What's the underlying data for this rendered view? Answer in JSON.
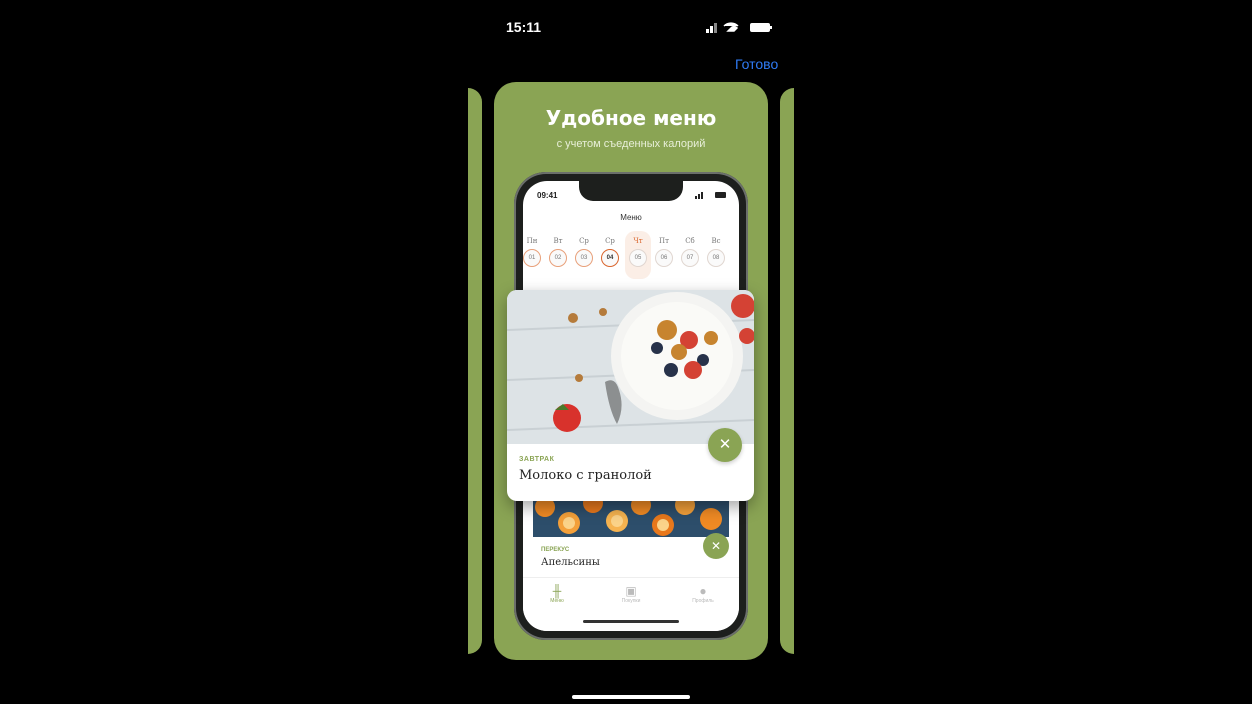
{
  "status_bar": {
    "time": "15:11"
  },
  "nav": {
    "done_label": "Готово"
  },
  "promo": {
    "title": "Удобное меню",
    "subtitle": "с учетом съеденных калорий",
    "accent_color": "#8aa454"
  },
  "phone": {
    "time": "09:41",
    "header": "Меню",
    "days": [
      {
        "name": "Пн",
        "num": "01"
      },
      {
        "name": "Вт",
        "num": "02"
      },
      {
        "name": "Ср",
        "num": "03"
      },
      {
        "name": "Ср",
        "num": "04"
      },
      {
        "name": "Чт",
        "num": "05"
      },
      {
        "name": "Пт",
        "num": "06"
      },
      {
        "name": "Сб",
        "num": "07"
      },
      {
        "name": "Вс",
        "num": "08"
      }
    ],
    "snack": {
      "label": "ПЕРЕКУС",
      "name": "Апельсины"
    },
    "tabs": [
      {
        "label": "Меню",
        "icon": "fork-knife-icon"
      },
      {
        "label": "Покупки",
        "icon": "basket-icon"
      },
      {
        "label": "Профиль",
        "icon": "user-icon"
      }
    ]
  },
  "meal_card": {
    "label": "ЗАВТРАК",
    "name": "Молоко с гранолой"
  }
}
